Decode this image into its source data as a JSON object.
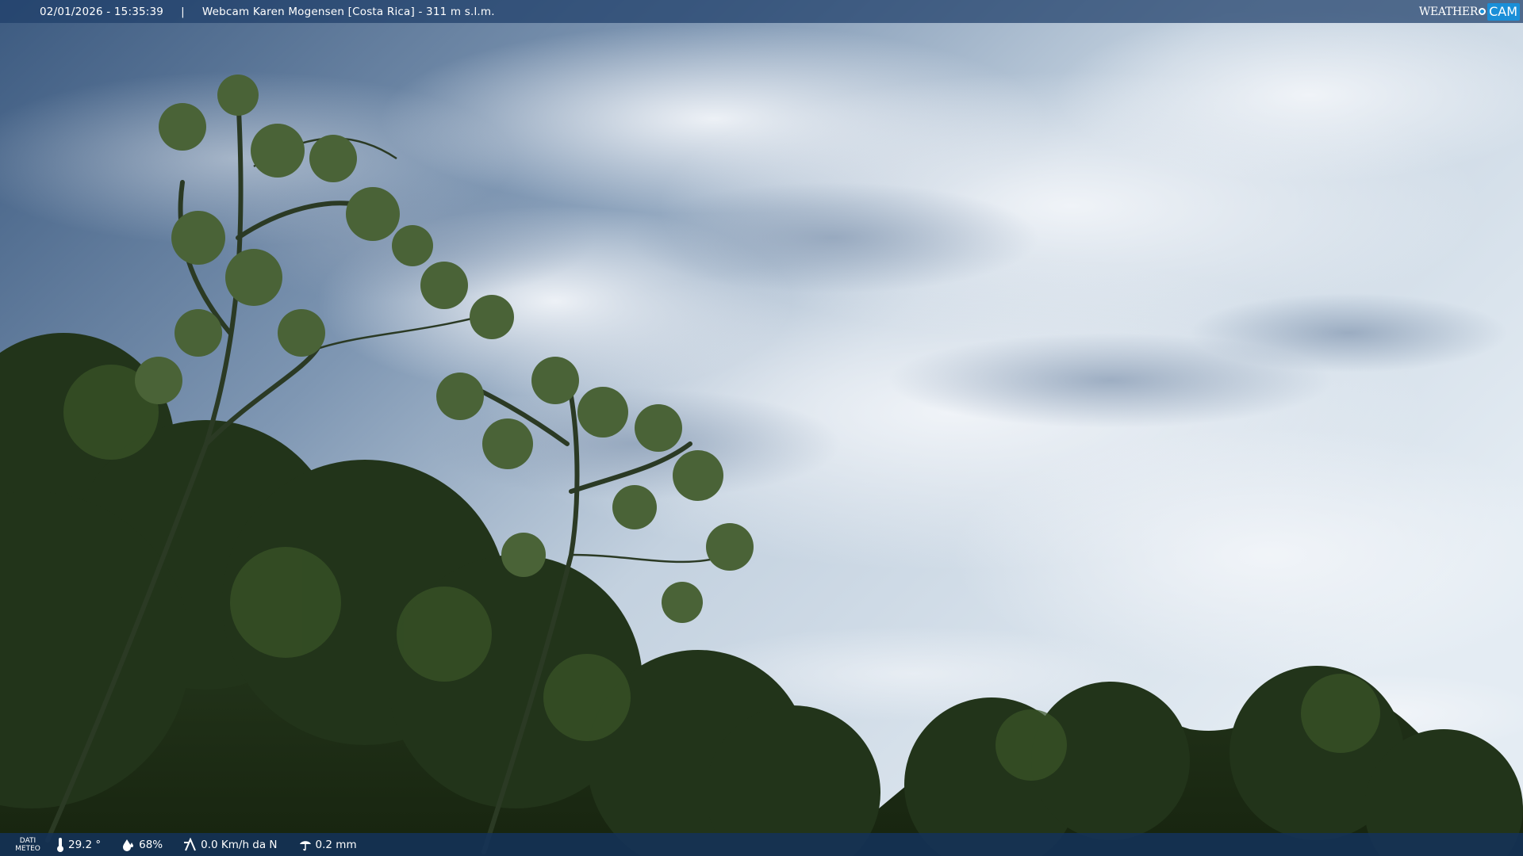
{
  "topbar": {
    "datetime": "02/01/2026 - 15:35:39",
    "separator": "|",
    "location": "Webcam Karen Mogensen [Costa Rica]  - 311 m s.l.m."
  },
  "brand": {
    "word_weather": "WEATHER",
    "word_cam": "CAM",
    "accent_color": "#1a8fd8"
  },
  "meteo": {
    "label_line1": "DATI",
    "label_line2": "METEO",
    "temperature": "29.2 °",
    "temperature_icon": "thermometer-icon",
    "humidity": "68%",
    "humidity_icon": "water-drop-icon",
    "wind": "0.0 Km/h da N",
    "wind_icon": "wind-icon",
    "rain": "0.2 mm",
    "rain_icon": "rain-icon"
  },
  "colors": {
    "sky_top": "#3f5f86",
    "sky_mid": "#c9d6e2",
    "foliage": "#23331c"
  }
}
